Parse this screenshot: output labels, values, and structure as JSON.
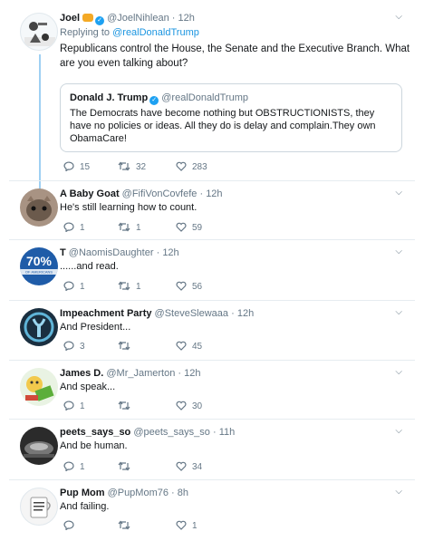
{
  "tweets": [
    {
      "name": "Joel",
      "handle": "@JoelNihlean",
      "sep": "·",
      "time": "12h",
      "replying_label": "Replying to",
      "replying_handle": "@realDonaldTrump",
      "text": "Republicans control the House, the Senate and the Executive Branch. What are you even talking about?",
      "quote": {
        "name": "Donald J. Trump",
        "handle": "@realDonaldTrump",
        "text": "The Democrats have become nothing but OBSTRUCTIONISTS, they have no policies or ideas. All they do is delay and complain.They own ObamaCare!"
      },
      "replies": "15",
      "retweets": "32",
      "likes": "283"
    },
    {
      "name": "A Baby Goat",
      "handle": "@FifiVonCovfefe",
      "sep": "·",
      "time": "12h",
      "text": "He's still learning how to count.",
      "replies": "1",
      "retweets": "1",
      "likes": "59"
    },
    {
      "name": "T",
      "handle": "@NaomisDaughter",
      "sep": "·",
      "time": "12h",
      "text": "......and read.",
      "replies": "1",
      "retweets": "1",
      "likes": "56"
    },
    {
      "name": "Impeachment Party",
      "handle": "@SteveSlewaaa",
      "sep": "·",
      "time": "12h",
      "text": "And President...",
      "replies": "3",
      "retweets": "",
      "likes": "45"
    },
    {
      "name": "James D.",
      "handle": "@Mr_Jamerton",
      "sep": "·",
      "time": "12h",
      "text": "And speak...",
      "replies": "1",
      "retweets": "",
      "likes": "30"
    },
    {
      "name": "peets_says_so",
      "handle": "@peets_says_so",
      "sep": "·",
      "time": "11h",
      "text": "And be human.",
      "replies": "1",
      "retweets": "",
      "likes": "34"
    },
    {
      "name": "Pup Mom",
      "handle": "@PupMom76",
      "sep": "·",
      "time": "8h",
      "text": "And failing.",
      "replies": "",
      "retweets": "",
      "likes": "1"
    }
  ],
  "avatar_labels": {
    "t_avatar": "70%",
    "t_avatar_sub": "OF AMERICANS"
  },
  "icons": {
    "reply": "reply-icon",
    "retweet": "retweet-icon",
    "like": "heart-icon",
    "caret": "chevron-down-icon",
    "verified": "verified-badge-icon"
  },
  "colors": {
    "link": "#1b95e0",
    "muted": "#657786",
    "thread": "#9fd0f3"
  }
}
